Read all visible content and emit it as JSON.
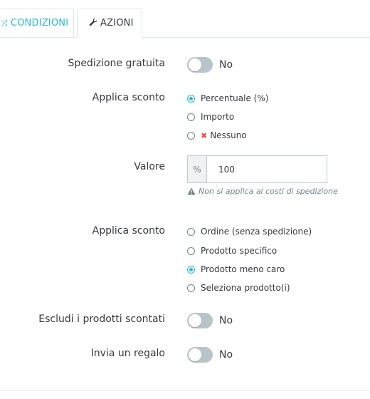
{
  "tabs": [
    {
      "label": "CONDIZIONI",
      "icon": "random-icon"
    },
    {
      "label": "AZIONI",
      "icon": "wrench-icon"
    }
  ],
  "free_shipping": {
    "label": "Spedizione gratuita",
    "state": "No"
  },
  "apply_discount": {
    "label": "Applica sconto",
    "options": [
      "Percentuale (%)",
      "Importo",
      "Nessuno"
    ],
    "selected": "Percentuale (%)"
  },
  "value": {
    "label": "Valore",
    "addon": "%",
    "input": "100",
    "help": "Non si applica ai costi di spedizione"
  },
  "apply_discount_to": {
    "label": "Applica sconto",
    "options": [
      "Ordine (senza spedizione)",
      "Prodotto specifico",
      "Prodotto meno caro",
      "Seleziona prodotto(i)"
    ],
    "selected": "Prodotto meno caro"
  },
  "exclude_discounted": {
    "label": "Escludi i prodotti scontati",
    "state": "No"
  },
  "send_gift": {
    "label": "Invia un regalo",
    "state": "No"
  },
  "colors": {
    "accent": "#25b9d7",
    "switch_off": "#b7c4c9",
    "danger": "#f54c3e"
  }
}
